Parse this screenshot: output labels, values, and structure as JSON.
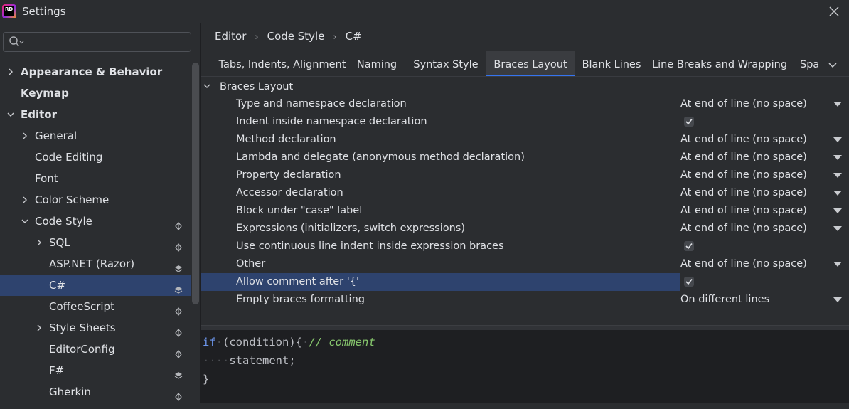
{
  "window": {
    "title": "Settings",
    "logo_text": "RD"
  },
  "search": {
    "placeholder": "",
    "value": ""
  },
  "sidebar": {
    "items": [
      {
        "label": "Appearance & Behavior",
        "bold": true,
        "arrow": "collapsed"
      },
      {
        "label": "Keymap",
        "bold": true,
        "arrow": "none"
      },
      {
        "label": "Editor",
        "bold": true,
        "arrow": "expanded"
      },
      {
        "label": "General",
        "arrow": "collapsed"
      },
      {
        "label": "Code Editing",
        "arrow": "none"
      },
      {
        "label": "Font",
        "arrow": "none"
      },
      {
        "label": "Color Scheme",
        "arrow": "collapsed"
      },
      {
        "label": "Code Style",
        "arrow": "expanded",
        "badge": "project-icon"
      },
      {
        "label": "SQL",
        "arrow": "collapsed",
        "badge": "project-icon"
      },
      {
        "label": "ASP.NET (Razor)",
        "arrow": "none",
        "badge": "layers-icon"
      },
      {
        "label": "C#",
        "arrow": "none",
        "badge": "layers-icon",
        "selected": true
      },
      {
        "label": "CoffeeScript",
        "arrow": "none",
        "badge": "project-icon"
      },
      {
        "label": "Style Sheets",
        "arrow": "collapsed",
        "badge": "project-icon"
      },
      {
        "label": "EditorConfig",
        "arrow": "none",
        "badge": "project-icon"
      },
      {
        "label": "F#",
        "arrow": "none",
        "badge": "layers-icon"
      },
      {
        "label": "Gherkin",
        "arrow": "none",
        "badge": "project-icon"
      }
    ]
  },
  "breadcrumb": [
    "Editor",
    "Code Style",
    "C#"
  ],
  "tabs": [
    {
      "label": "Tabs, Indents, Alignment"
    },
    {
      "label": "Naming"
    },
    {
      "label": "Syntax Style"
    },
    {
      "label": "Braces Layout",
      "active": true
    },
    {
      "label": "Blank Lines"
    },
    {
      "label": "Line Breaks and Wrapping"
    },
    {
      "label": "Spa"
    }
  ],
  "section": {
    "label": "Braces Layout"
  },
  "options": [
    {
      "label": "Type and namespace declaration",
      "type": "dropdown",
      "value": "At end of line (no space)"
    },
    {
      "label": "Indent inside namespace declaration",
      "type": "checkbox",
      "checked": true
    },
    {
      "label": "Method declaration",
      "type": "dropdown",
      "value": "At end of line (no space)"
    },
    {
      "label": "Lambda and delegate (anonymous method declaration)",
      "type": "dropdown",
      "value": "At end of line (no space)"
    },
    {
      "label": "Property declaration",
      "type": "dropdown",
      "value": "At end of line (no space)"
    },
    {
      "label": "Accessor declaration",
      "type": "dropdown",
      "value": "At end of line (no space)"
    },
    {
      "label": "Block under \"case\" label",
      "type": "dropdown",
      "value": "At end of line (no space)"
    },
    {
      "label": "Expressions (initializers, switch expressions)",
      "type": "dropdown",
      "value": "At end of line (no space)"
    },
    {
      "label": "Use continuous line indent inside expression braces",
      "type": "checkbox",
      "checked": true
    },
    {
      "label": "Other",
      "type": "dropdown",
      "value": "At end of line (no space)"
    },
    {
      "label": "Allow comment after '{'",
      "type": "checkbox",
      "checked": true,
      "selected": true
    },
    {
      "label": "Empty braces formatting",
      "type": "dropdown",
      "value": "On different lines"
    }
  ],
  "preview": {
    "line1": {
      "keyword": "if",
      "text": "(condition){",
      "comment": "// comment"
    },
    "line2": {
      "indent": "····",
      "text": "statement;"
    },
    "line3": {
      "text": "}"
    }
  },
  "colors": {
    "background": "#2b2d30",
    "selection": "#2e436e",
    "accent": "#3574f0",
    "editor_bg": "#1e1f22",
    "keyword": "#6c95eb",
    "comment": "#85c46c"
  }
}
